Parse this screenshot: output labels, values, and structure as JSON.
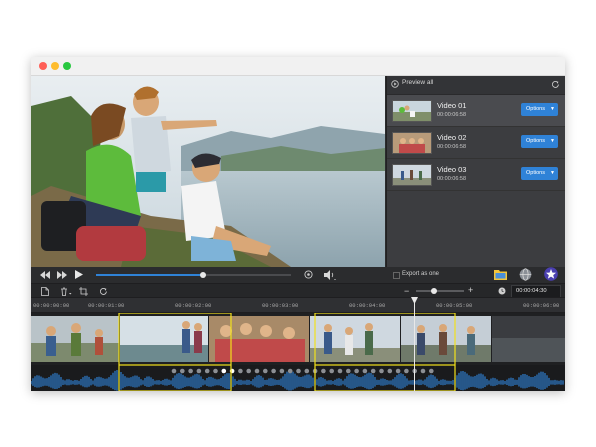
{
  "window": {
    "traffic_lights": [
      "#ff5f57",
      "#febc2e",
      "#28c840"
    ]
  },
  "panel": {
    "header": "Preview all",
    "items": [
      {
        "name": "Video 01",
        "duration": "00:00:06:58",
        "button": "Options"
      },
      {
        "name": "Video 02",
        "duration": "00:00:06:58",
        "button": "Options"
      },
      {
        "name": "Video 03",
        "duration": "00:00:06:58",
        "button": "Options"
      }
    ]
  },
  "player": {
    "progress": 0.55,
    "export_label": "Export as one"
  },
  "toolbar": {
    "zoom_level": 0.38,
    "timecode": "00:00:04:30"
  },
  "ruler": {
    "ticks": [
      "00:00:00:00",
      "00:00:01:00",
      "00:00:02:00",
      "00:00:03:00",
      "00:00:04:00",
      "00:00:05:00",
      "00:00:06:00"
    ]
  },
  "colors": {
    "accent": "#2f82d7",
    "selection": "#f2e11c",
    "waveform": "#2f7fd0",
    "panel_bg": "#3c3d40",
    "dark_bg": "#2b2c2e"
  }
}
